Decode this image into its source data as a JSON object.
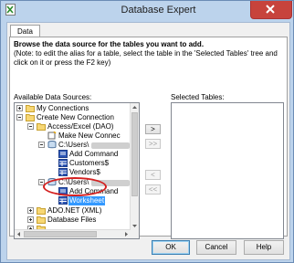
{
  "window": {
    "title": "Database Expert"
  },
  "tabs": [
    {
      "label": "Data"
    }
  ],
  "instructions": {
    "heading": "Browse the data source for the tables you want to add.",
    "note": "(Note: to edit the alias for a table, select the table in the 'Selected Tables' tree and click on it or press the F2 key)"
  },
  "labels": {
    "available": "Available Data Sources:",
    "selected": "Selected Tables:"
  },
  "tree": [
    {
      "label": "My Connections"
    },
    {
      "label": "Create New Connection"
    },
    {
      "label": "Access/Excel (DAO)"
    },
    {
      "label": "Make New Connec"
    },
    {
      "label": "C:\\Users\\"
    },
    {
      "label": "Add Command"
    },
    {
      "label": "Customers$"
    },
    {
      "label": "Vendors$"
    },
    {
      "label": "C:\\Users\\"
    },
    {
      "label": "Add Command"
    },
    {
      "label": "Worksheet"
    },
    {
      "label": "ADO.NET (XML)"
    },
    {
      "label": "Database Files"
    }
  ],
  "transfer_buttons": {
    "add": ">",
    "add_all": ">>",
    "remove": "<",
    "remove_all": "<<"
  },
  "footer": {
    "ok": "OK",
    "cancel": "Cancel",
    "help": "Help"
  },
  "colors": {
    "selection": "#3399ff",
    "annotation_circle": "#d42020",
    "close_button": "#c7433c"
  }
}
